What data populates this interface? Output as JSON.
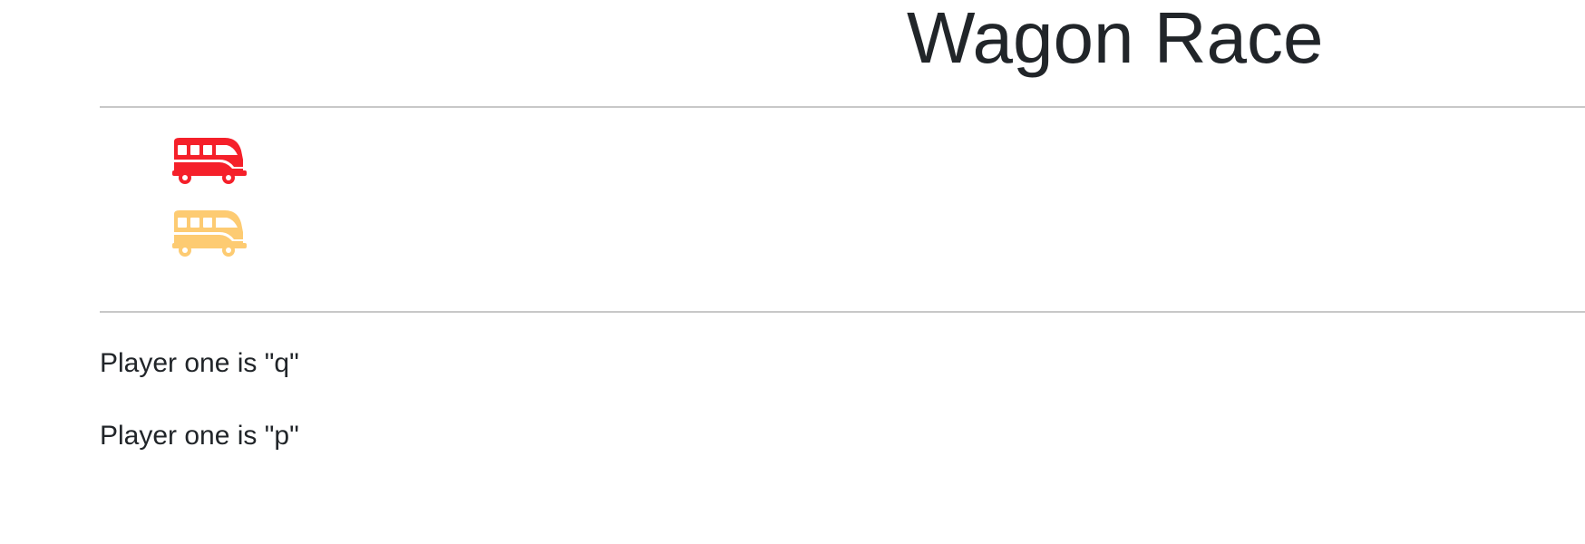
{
  "title": "Wagon Race",
  "players": [
    {
      "icon": "bus-icon",
      "color": "#f5202a"
    },
    {
      "icon": "bus-icon",
      "color": "#fdcb72"
    }
  ],
  "instructions": [
    "Player one is \"q\"",
    "Player one is \"p\""
  ]
}
